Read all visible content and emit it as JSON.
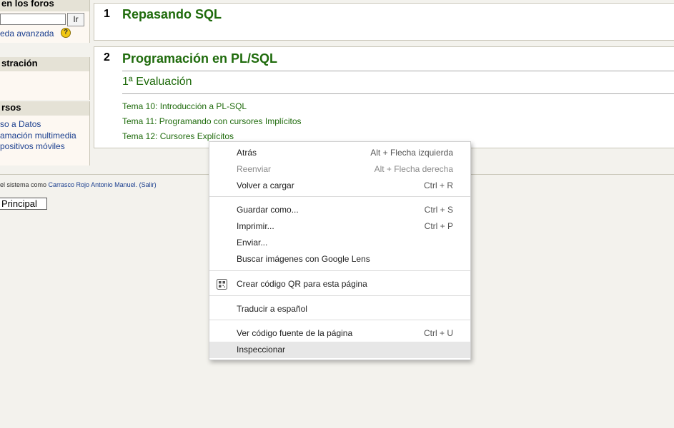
{
  "sidebar": {
    "forum_header": "en los foros",
    "go_button": "Ir",
    "advanced_search": "eda avanzada",
    "help_glyph": "?",
    "admin_header": "stración",
    "courses_header": "rsos",
    "courses": [
      "so a Datos",
      "amación multimedia",
      "positivos móviles"
    ]
  },
  "sections": [
    {
      "number": "1",
      "title": "Repasando SQL"
    },
    {
      "number": "2",
      "title": "Programación en PL/SQL",
      "subtitle": "1ª Evaluación",
      "topics": [
        "Tema 10: Introducción a PL-SQL",
        "Tema 11: Programando con cursores Implícitos",
        "Tema 12: Cursores Explícitos"
      ]
    }
  ],
  "footer": {
    "login_prefix": "el sistema como",
    "user_name": "Carrasco Rojo Antonio Manuel.",
    "logout": "(Salir)",
    "home_button": "Principal"
  },
  "context_menu": {
    "items": [
      {
        "label": "Atrás",
        "shortcut": "Alt + Flecha izquierda",
        "disabled": false
      },
      {
        "label": "Reenviar",
        "shortcut": "Alt + Flecha derecha",
        "disabled": true
      },
      {
        "label": "Volver a cargar",
        "shortcut": "Ctrl + R",
        "disabled": false
      },
      {
        "label": "Guardar como...",
        "shortcut": "Ctrl + S",
        "disabled": false
      },
      {
        "label": "Imprimir...",
        "shortcut": "Ctrl + P",
        "disabled": false
      },
      {
        "label": "Enviar...",
        "shortcut": "",
        "disabled": false
      },
      {
        "label": "Buscar imágenes con Google Lens",
        "shortcut": "",
        "disabled": false
      },
      {
        "label": "Crear código QR para esta página",
        "shortcut": "",
        "disabled": false,
        "icon": "qr-code-icon"
      },
      {
        "label": "Traducir a español",
        "shortcut": "",
        "disabled": false
      },
      {
        "label": "Ver código fuente de la página",
        "shortcut": "Ctrl + U",
        "disabled": false
      },
      {
        "label": "Inspeccionar",
        "shortcut": "",
        "disabled": false,
        "highlighted": true
      }
    ]
  },
  "colors": {
    "section_title": "#1f6b0c",
    "link": "#1b3f8f",
    "page_background": "#f3f2ed"
  }
}
